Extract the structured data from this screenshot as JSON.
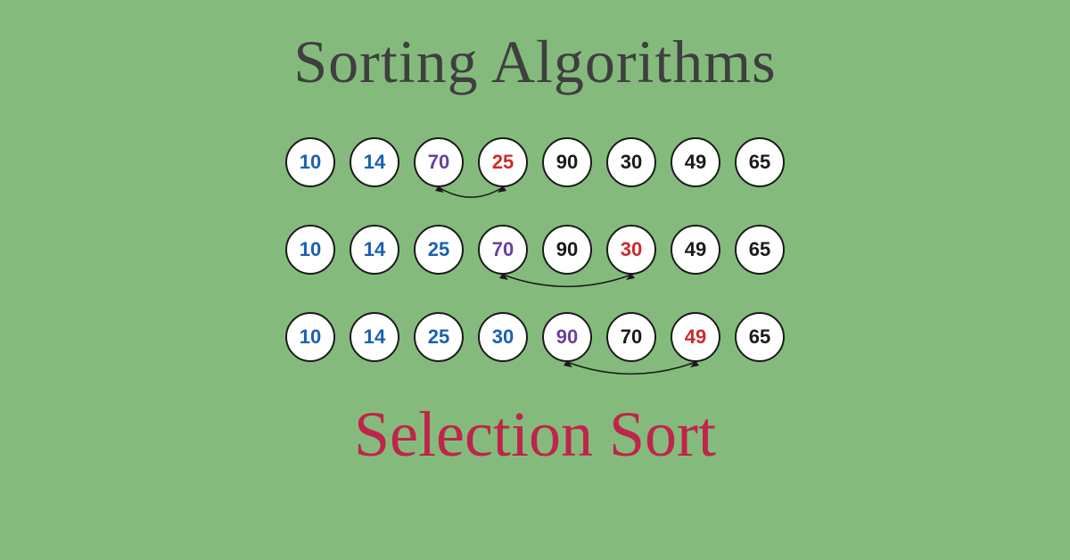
{
  "title": "Sorting Algorithms",
  "subtitle": "Selection Sort",
  "rows": [
    {
      "cells": [
        {
          "value": "10",
          "color": "blue"
        },
        {
          "value": "14",
          "color": "blue"
        },
        {
          "value": "70",
          "color": "purple"
        },
        {
          "value": "25",
          "color": "red"
        },
        {
          "value": "90",
          "color": "black"
        },
        {
          "value": "30",
          "color": "black"
        },
        {
          "value": "49",
          "color": "black"
        },
        {
          "value": "65",
          "color": "black"
        }
      ],
      "arrow": {
        "from": 2,
        "to": 3
      }
    },
    {
      "cells": [
        {
          "value": "10",
          "color": "blue"
        },
        {
          "value": "14",
          "color": "blue"
        },
        {
          "value": "25",
          "color": "blue"
        },
        {
          "value": "70",
          "color": "purple"
        },
        {
          "value": "90",
          "color": "black"
        },
        {
          "value": "30",
          "color": "red"
        },
        {
          "value": "49",
          "color": "black"
        },
        {
          "value": "65",
          "color": "black"
        }
      ],
      "arrow": {
        "from": 3,
        "to": 5
      }
    },
    {
      "cells": [
        {
          "value": "10",
          "color": "blue"
        },
        {
          "value": "14",
          "color": "blue"
        },
        {
          "value": "25",
          "color": "blue"
        },
        {
          "value": "30",
          "color": "blue"
        },
        {
          "value": "90",
          "color": "purple"
        },
        {
          "value": "70",
          "color": "black"
        },
        {
          "value": "49",
          "color": "red"
        },
        {
          "value": "65",
          "color": "black"
        }
      ],
      "arrow": {
        "from": 4,
        "to": 6
      }
    }
  ]
}
